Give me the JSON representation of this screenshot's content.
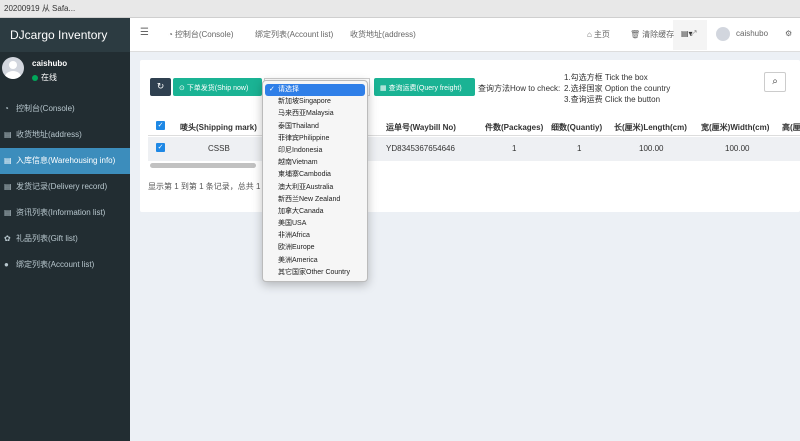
{
  "window": {
    "title": "20200919 从 Safa..."
  },
  "app": {
    "brand": "DJcargo Inventory"
  },
  "user": {
    "name": "caishubo",
    "status": "在线"
  },
  "sidebar": {
    "items": [
      {
        "label": "控制台(Console)",
        "icon": "dashboard-icon",
        "active": false
      },
      {
        "label": "收货地址(address)",
        "icon": "list-icon",
        "active": false
      },
      {
        "label": "入库信息(Warehousing info)",
        "icon": "list-icon",
        "active": true
      },
      {
        "label": "发货记录(Delivery record)",
        "icon": "list-icon",
        "active": false
      },
      {
        "label": "资讯列表(Information list)",
        "icon": "list-icon",
        "active": false
      },
      {
        "label": "礼品列表(Gift list)",
        "icon": "gift-icon",
        "active": false
      },
      {
        "label": "绑定列表(Account list)",
        "icon": "info-icon",
        "active": false
      }
    ]
  },
  "navbar": {
    "tabs": [
      {
        "label": "控制台(Console)"
      },
      {
        "label": "绑定列表(Account list)"
      },
      {
        "label": "收货地址(address)"
      }
    ],
    "home_label": "主页",
    "clear_cache_label": "清除缓存",
    "username": "caishubo"
  },
  "toolbar": {
    "ship_now_label": "下单发货(Ship now)",
    "query_freight_label": "查询运费(Query freight)",
    "query_method_label": "查询方法How to check:",
    "instructions": [
      "1.勾选方框 Tick the box",
      "2.选择国家 Option the country",
      "3.查询运费 Click the button"
    ]
  },
  "table": {
    "columns": [
      "唛头(Shipping mark)",
      "运单号(Waybill No)",
      "件数(Packages)",
      "细数(Quantiy)",
      "长(厘米)Length(cm)",
      "宽(厘米)Width(cm)",
      "高(厘"
    ],
    "rows": [
      {
        "shipping_mark": "CSSB",
        "waybill_no": "YD8345367654646",
        "packages": "1",
        "quantity": "1",
        "length": "100.00",
        "width": "100.00"
      }
    ],
    "footer": "显示第 1 到第 1 条记录，总共 1 条记录"
  },
  "country_dropdown": {
    "selected": "请选择",
    "options": [
      "请选择",
      "新加坡Singapore",
      "马来西亚Malaysia",
      "泰国Thailand",
      "菲律宾Philippine",
      "印尼Indonesia",
      "越南Vietnam",
      "柬埔寨Cambodia",
      "澳大利亚Australia",
      "新西兰New Zealand",
      "加拿大Canada",
      "美国USA",
      "非洲Africa",
      "欧洲Europe",
      "美洲America",
      "其它国家Other Country"
    ]
  },
  "colors": {
    "sidebar_bg": "#222d32",
    "active_item": "#3c8dbc",
    "green_button": "#1ab394",
    "dark_button": "#2f4050",
    "checkbox": "#1e88e5",
    "dropdown_selected": "#2f7fe8"
  }
}
